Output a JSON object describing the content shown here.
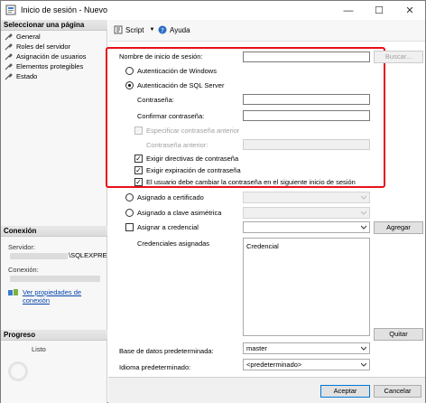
{
  "window": {
    "title": "Inicio de sesión - Nuevo",
    "minimize": "—",
    "maximize": "☐",
    "close": "✕"
  },
  "sidebar": {
    "select_page_header": "Seleccionar una página",
    "items": [
      {
        "label": "General"
      },
      {
        "label": "Roles del servidor"
      },
      {
        "label": "Asignación de usuarios"
      },
      {
        "label": "Elementos protegibles"
      },
      {
        "label": "Estado"
      }
    ],
    "connection_header": "Conexión",
    "server_label": "Servidor:",
    "server_value": "\\SQLEXPRE",
    "connection_label": "Conexión:",
    "view_connection_link": "Ver propiedades de conexión",
    "progress_header": "Progreso",
    "progress_status": "Listo"
  },
  "toolbar": {
    "script_label": "Script",
    "help_label": "Ayuda"
  },
  "form": {
    "login_name_label": "Nombre de inicio de sesión:",
    "login_name_value": "",
    "search_button": "Buscar...",
    "windows_auth_label": "Autenticación de Windows",
    "sql_auth_label": "Autenticación de SQL Server",
    "password_label": "Contraseña:",
    "confirm_password_label": "Confirmar contraseña:",
    "specify_old_password_label": "Especificar contraseña anterior",
    "old_password_label": "Contraseña anterior:",
    "enforce_policy_label": "Exigir directivas de contraseña",
    "enforce_expiration_label": "Exigir expiración de contraseña",
    "must_change_label": "El usuario debe cambiar la contraseña en el siguiente inicio de sesión",
    "mapped_certificate_label": "Asignado a certificado",
    "mapped_asymmetric_label": "Asignado a clave asimétrica",
    "map_credential_label": "Asignar a credencial",
    "add_button": "Agregar",
    "mapped_credentials_label": "Credenciales asignadas",
    "credential_column": "Credencial",
    "remove_button": "Quitar",
    "default_db_label": "Base de datos predeterminada:",
    "default_db_value": "master",
    "default_lang_label": "Idioma predeterminado:",
    "default_lang_value": "<predeterminado>"
  },
  "footer": {
    "ok_button": "Aceptar",
    "cancel_button": "Cancelar"
  },
  "colors": {
    "highlight_border": "#e8111a",
    "link": "#0645ad"
  }
}
